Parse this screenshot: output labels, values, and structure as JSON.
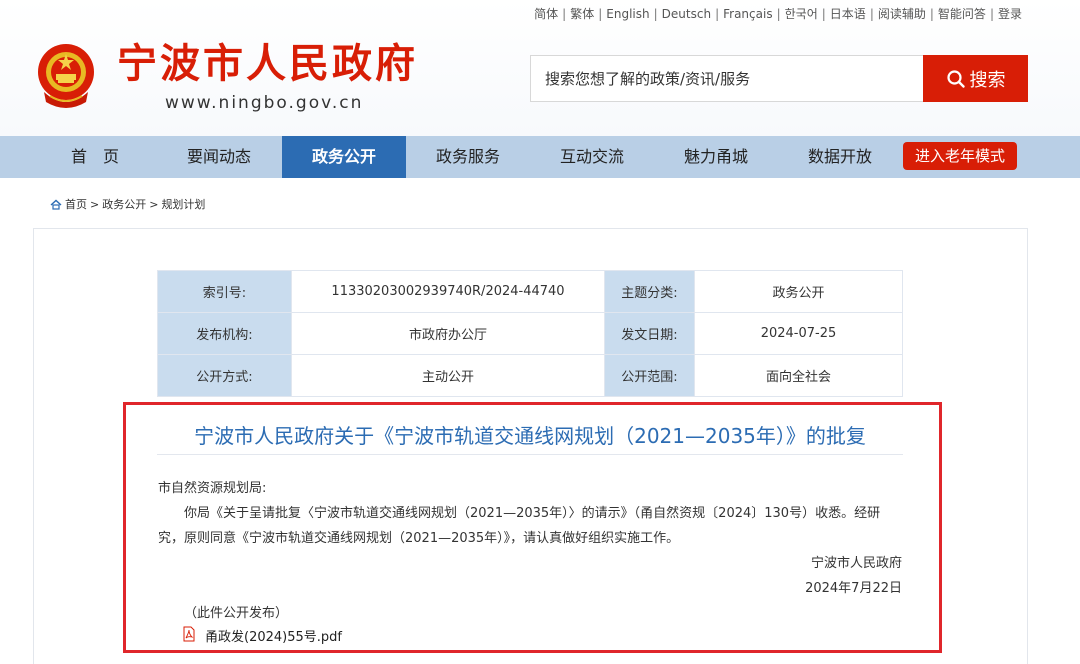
{
  "header": {
    "top_links": [
      "简体",
      "繁体",
      "English",
      "Deutsch",
      "Français",
      "한국어",
      "日本语",
      "阅读辅助",
      "智能问答",
      "登录"
    ],
    "site_title": "宁波市人民政府",
    "site_url": "www.ningbo.gov.cn",
    "search_placeholder": "搜索您想了解的政策/资讯/服务",
    "search_button": "搜索"
  },
  "nav": {
    "items": [
      "首　页",
      "要闻动态",
      "政务公开",
      "政务服务",
      "互动交流",
      "魅力甬城",
      "数据开放"
    ],
    "active": "政务公开",
    "elder_mode": "进入老年模式"
  },
  "breadcrumb": {
    "items": [
      "首页",
      "政务公开",
      "规划计划"
    ],
    "separator": ">"
  },
  "meta": {
    "index_label": "索引号:",
    "index_value": "11330203002939740R/2024-44740",
    "topic_label": "主题分类:",
    "topic_value": "政务公开",
    "publisher_label": "发布机构:",
    "publisher_value": "市政府办公厅",
    "date_label": "发文日期:",
    "date_value": "2024-07-25",
    "disclosure_label": "公开方式:",
    "disclosure_value": "主动公开",
    "scope_label": "公开范围:",
    "scope_value": "面向全社会"
  },
  "document": {
    "title": "宁波市人民政府关于《宁波市轨道交通线网规划（2021—2035年）》的批复",
    "recipient": "市自然资源规划局:",
    "para_line1": "你局《关于呈请批复〈宁波市轨道交通线网规划（2021—2035年）〉的请示》（甬自然资规〔2024〕130号）收悉。经研",
    "para_line2": "究，原则同意《宁波市轨道交通线网规划（2021—2035年）》，请认真做好组织实施工作。",
    "signature": "宁波市人民政府",
    "sign_date": "2024年7月22日",
    "note": "（此件公开发布）",
    "attachment": "甬政发(2024)55号.pdf"
  },
  "colors": {
    "brand_red": "#d81e06",
    "nav_bg": "#b9cfe6",
    "nav_active": "#2c6cb3",
    "title_blue": "#2c6cb3",
    "highlight_border": "#e0262b",
    "label_bg": "#c9dcee"
  }
}
